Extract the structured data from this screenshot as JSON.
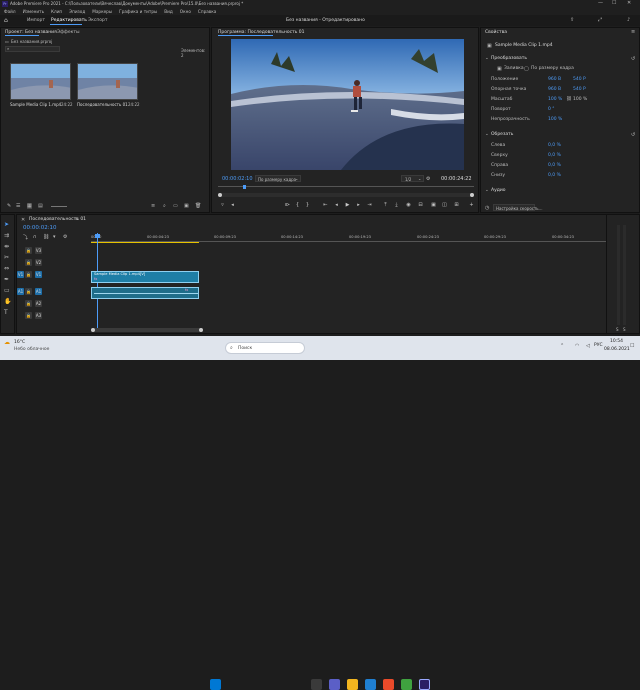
{
  "window": {
    "title": "Adobe Premiere Pro 2021 - C:\\Пользователи\\Вячеслав\\Документы\\Adobe\\Premiere Pro\\15.0\\Без названия.prproj *",
    "controls": [
      "—",
      "☐",
      "✕"
    ]
  },
  "menu": [
    "Файл",
    "Изменить",
    "Клип",
    "Эпизод",
    "Маркеры",
    "Графика и титры",
    "Вид",
    "Окно",
    "Справка"
  ],
  "workspace": {
    "tabs": [
      "Импорт",
      "Редактировать",
      "Экспорт"
    ],
    "active": 1,
    "center_title": "Без названия - Отредактировано"
  },
  "project": {
    "tab": "Проект: Без названия",
    "tab2": "Эффекты",
    "file": "Без названия.prproj",
    "count": "Элементов: 2",
    "items": [
      {
        "name": "Sample Media Clip 1.mp4",
        "dur": "24:22"
      },
      {
        "name": "Последовательность 01",
        "dur": "24:22"
      }
    ]
  },
  "monitor": {
    "title": "Программа: Последовательность 01",
    "timecode": "00:00:02:10",
    "fit": "По размеру кадра",
    "quality": "1/2",
    "duration": "00:00:24:22"
  },
  "properties": {
    "title": "Свойства",
    "clip": "Sample Media Clip 1.mp4",
    "transform": {
      "label": "Преобразовать",
      "scale_label": "Заливка",
      "fit_label": "По размеру кадра",
      "rows": [
        {
          "label": "Положение",
          "v1": "960 В",
          "v2": "540 Р"
        },
        {
          "label": "Опорная точка",
          "v1": "960 В",
          "v2": "540 Р"
        },
        {
          "label": "Масштаб",
          "v1": "100 %",
          "v2": "100 %"
        },
        {
          "label": "Поворот",
          "v1": "0 °",
          "v2": ""
        },
        {
          "label": "Непрозрачность",
          "v1": "100 %",
          "v2": ""
        }
      ]
    },
    "crop": {
      "label": "Обрезать",
      "rows": [
        {
          "label": "Слева",
          "v": "0,0 %"
        },
        {
          "label": "Сверху",
          "v": "0,0 %"
        },
        {
          "label": "Справа",
          "v": "0,0 %"
        },
        {
          "label": "Снизу",
          "v": "0,0 %"
        }
      ]
    },
    "audio": {
      "label": "Аудио",
      "speed_label": "Настройка скорость..."
    }
  },
  "timeline": {
    "tab": "Последовательность 01",
    "timecode": "00:00:02:10",
    "ruler": [
      "00:00",
      "00:00:04:23",
      "00:00:09:23",
      "00:00:14:23",
      "00:00:19:23",
      "00:00:24:23",
      "00:00:29:23",
      "00:00:34:23",
      "00:00:39:23",
      "00:00:44:22"
    ],
    "video_tracks": [
      "V3",
      "V2",
      "V1"
    ],
    "audio_tracks": [
      "A1",
      "A2",
      "A3"
    ],
    "clip_label": "Sample Media Clip 1.mp4[V]",
    "clip_fx": "fx"
  },
  "status": {
    "temp": "16°C",
    "weather": "Небо облачное"
  },
  "taskbar": {
    "search": "Поиск",
    "lang": "РУС",
    "time": "10:54",
    "date": "08.06.2021"
  },
  "colors": {
    "accent": "#2d8ceb",
    "timecode": "#4d9cf8",
    "clip_v": "#1e7ea6",
    "clip_a": "#1f6d8a",
    "panel": "#232323",
    "bg": "#1d1d1d"
  }
}
